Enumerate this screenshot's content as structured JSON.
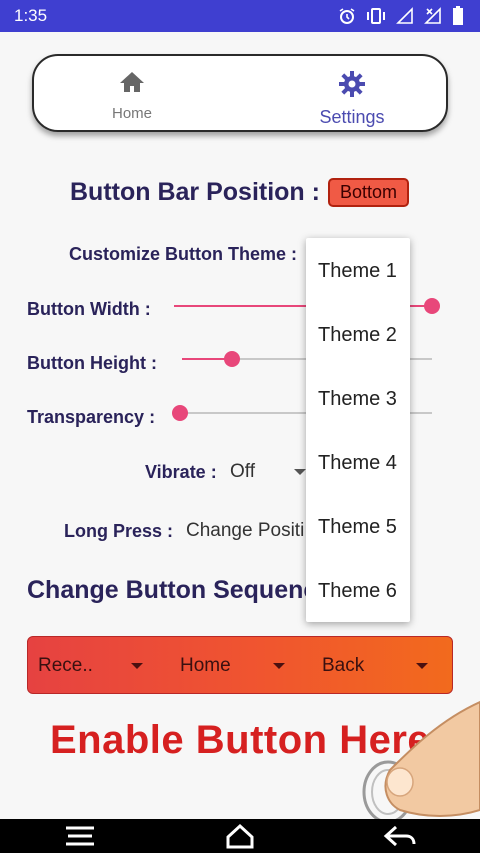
{
  "status_bar": {
    "time": "1:35"
  },
  "nav": {
    "home_label": "Home",
    "settings_label": "Settings",
    "icons": [
      "home-icon",
      "gear-icon"
    ]
  },
  "settings": {
    "title": "Button Bar Position :",
    "position_value": "Bottom",
    "customize_label": "Customize Button Theme :",
    "width_label": "Button Width :",
    "width_value": 1.0,
    "height_label": "Button Height :",
    "height_value": 0.2,
    "transparency_label": "Transparency :",
    "transparency_value": 0.0,
    "vibrate_label": "Vibrate :",
    "vibrate_value": "Off",
    "long_press_label": "Long Press :",
    "long_press_value": "Change Positi",
    "sequence_title": "Change Button Sequence"
  },
  "button_bar": {
    "slots": [
      "Rece..",
      "Home",
      "Back"
    ]
  },
  "enable_text": "Enable Button Here",
  "theme_dropdown": {
    "options": [
      "Theme 1",
      "Theme 2",
      "Theme 3",
      "Theme 4",
      "Theme 5",
      "Theme 6"
    ]
  },
  "colors": {
    "status_bar": "#3f3fd0",
    "accent": "#e8477a",
    "title": "#2a235a",
    "enable": "#d62020"
  }
}
